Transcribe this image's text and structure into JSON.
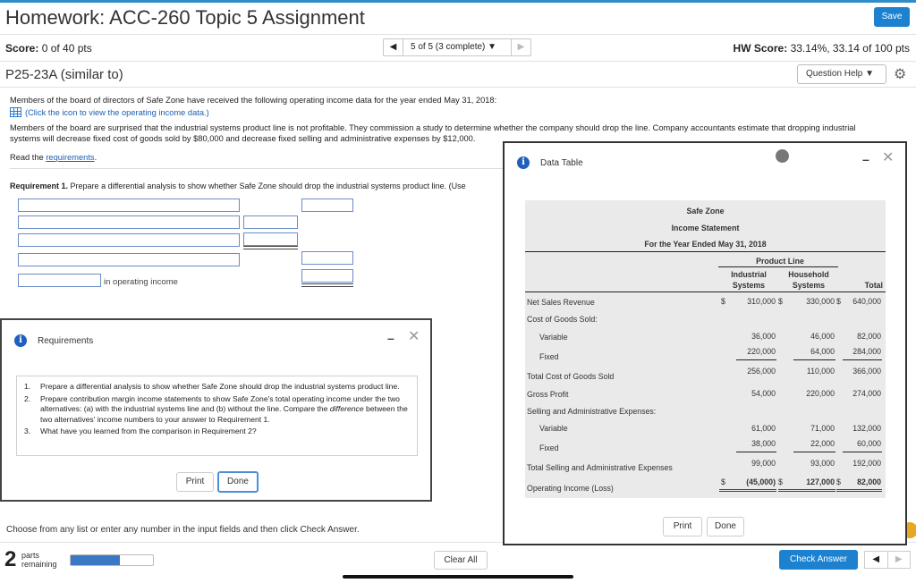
{
  "header": {
    "title": "Homework: ACC-260 Topic 5 Assignment",
    "save_label": "Save"
  },
  "score_bar": {
    "score_label": "Score:",
    "score_value": "0 of 40 pts",
    "nav_position": "5 of 5 (3 complete)",
    "hw_score_label": "HW Score:",
    "hw_score_value": "33.14%, 33.14 of 100 pts"
  },
  "problem": {
    "id": "P25-23A (similar to)",
    "question_help": "Question Help"
  },
  "content": {
    "intro": "Members of the board of directors of Safe Zone have received the following operating income data for the year ended May 31, 2018:",
    "data_link": "(Click the icon to view the operating income data.)",
    "surprised_line1": "Members of the board are surprised that the industrial systems product line is not profitable. They commission a study to determine whether the company should drop the line. Company accountants estimate that dropping industrial",
    "surprised_line2": "systems will decrease fixed cost of goods sold by $80,000 and decrease fixed selling and administrative expenses by $12,000.",
    "read_prefix": "Read the",
    "requirements_link": "requirements",
    "read_suffix": ".",
    "requirement1_label": "Requirement 1.",
    "requirement1_text": "Prepare a differential analysis to show whether Safe Zone should drop the industrial systems product line. (Use",
    "in_operating_income": "in operating income"
  },
  "requirements_dialog": {
    "title": "Requirements",
    "items": [
      {
        "num": "1.",
        "text": "Prepare a differential analysis to show whether Safe Zone should drop the industrial systems product line."
      },
      {
        "num": "2.",
        "text_a": "Prepare contribution margin income statements to show Safe Zone's total operating income under the two alternatives: (a) with the industrial systems line and (b) without the line. Compare the ",
        "text_em": "difference",
        "text_b": " between the two alternatives' income numbers to your answer to Requirement 1."
      },
      {
        "num": "3.",
        "text": "What have you learned from the comparison in Requirement 2?"
      }
    ],
    "print_label": "Print",
    "done_label": "Done"
  },
  "footer": {
    "instruction": "Choose from any list or enter any number in the input fields and then click Check Answer.",
    "parts_count": "2",
    "parts_label_1": "parts",
    "parts_label_2": "remaining",
    "progress_fraction": 0.6,
    "clear_all": "Clear All",
    "check_answer": "Check Answer"
  },
  "data_table": {
    "title": "Data Table",
    "company": "Safe Zone",
    "statement": "Income Statement",
    "period": "For the Year Ended May 31, 2018",
    "product_line_header": "Product Line",
    "col_industrial_1": "Industrial",
    "col_industrial_2": "Systems",
    "col_household_1": "Household",
    "col_household_2": "Systems",
    "col_total": "Total",
    "rows": {
      "net_sales": {
        "label": "Net Sales Revenue",
        "ind": "310,000",
        "hh": "330,000",
        "tot": "640,000"
      },
      "cogs_header": {
        "label": "Cost of Goods Sold:"
      },
      "cogs_variable": {
        "label": "Variable",
        "ind": "36,000",
        "hh": "46,000",
        "tot": "82,000"
      },
      "cogs_fixed": {
        "label": "Fixed",
        "ind": "220,000",
        "hh": "64,000",
        "tot": "284,000"
      },
      "total_cogs": {
        "label": "Total Cost of Goods Sold",
        "ind": "256,000",
        "hh": "110,000",
        "tot": "366,000"
      },
      "gross_profit": {
        "label": "Gross Profit",
        "ind": "54,000",
        "hh": "220,000",
        "tot": "274,000"
      },
      "sga_header": {
        "label": "Selling and Administrative Expenses:"
      },
      "sga_variable": {
        "label": "Variable",
        "ind": "61,000",
        "hh": "71,000",
        "tot": "132,000"
      },
      "sga_fixed": {
        "label": "Fixed",
        "ind": "38,000",
        "hh": "22,000",
        "tot": "60,000"
      },
      "total_sga": {
        "label": "Total Selling and Administrative Expenses",
        "ind": "99,000",
        "hh": "93,000",
        "tot": "192,000"
      },
      "operating_income": {
        "label": "Operating Income (Loss)",
        "ind": "(45,000)",
        "hh": "127,000",
        "tot": "82,000"
      }
    },
    "dollar_sign": "$",
    "print_label": "Print",
    "done_label": "Done"
  }
}
